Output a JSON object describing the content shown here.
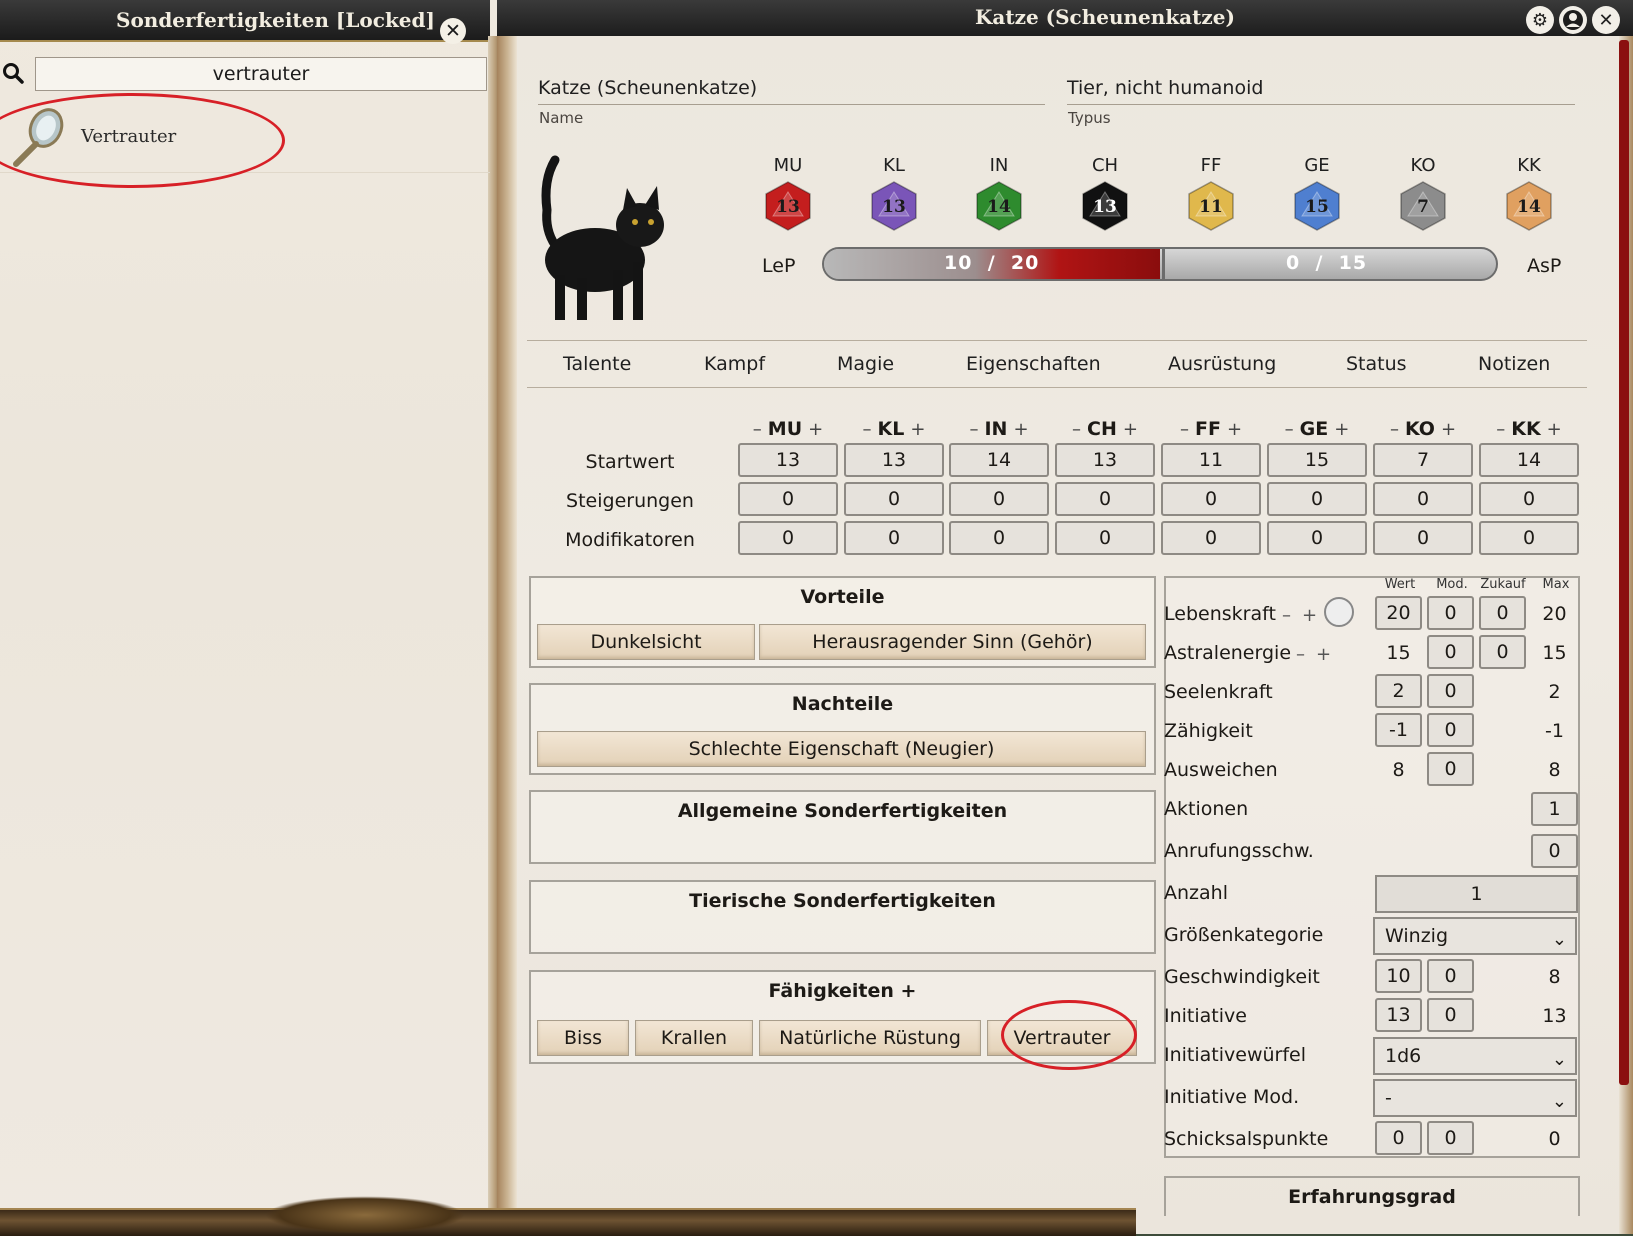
{
  "left_window": {
    "title": "Sonderfertigkeiten [Locked]",
    "search_value": "vertrauter",
    "results": [
      {
        "label": "Vertrauter"
      }
    ]
  },
  "right_window": {
    "title": "Katze (Scheunenkatze)",
    "name_value": "Katze (Scheunenkatze)",
    "name_caption": "Name",
    "type_value": "Tier, nicht humanoid",
    "type_caption": "Typus"
  },
  "attributes": [
    {
      "key": "MU",
      "value": "13",
      "color": "#c41e1e"
    },
    {
      "key": "KL",
      "value": "13",
      "color": "#7a55b8"
    },
    {
      "key": "IN",
      "value": "14",
      "color": "#2e8b2e"
    },
    {
      "key": "CH",
      "value": "13",
      "color": "#111111"
    },
    {
      "key": "FF",
      "value": "11",
      "color": "#e0b84c"
    },
    {
      "key": "GE",
      "value": "15",
      "color": "#4f7fd0"
    },
    {
      "key": "KO",
      "value": "7",
      "color": "#8c8c8c"
    },
    {
      "key": "KK",
      "value": "14",
      "color": "#e0a060"
    }
  ],
  "resources": {
    "lep_label": "LeP",
    "lep_current": "10",
    "lep_max": "20",
    "lep_fraction": 0.5,
    "asp_label": "AsP",
    "asp_current": "0",
    "asp_max": "15",
    "asp_fraction": 0.0,
    "separator": "/"
  },
  "tabs": [
    "Talente",
    "Kampf",
    "Magie",
    "Eigenschaften",
    "Ausrüstung",
    "Status",
    "Notizen"
  ],
  "attr_table": {
    "minus": "–",
    "plus": "+",
    "rows": [
      {
        "label": "Startwert",
        "values": [
          "13",
          "13",
          "14",
          "13",
          "11",
          "15",
          "7",
          "14"
        ]
      },
      {
        "label": "Steigerungen",
        "values": [
          "0",
          "0",
          "0",
          "0",
          "0",
          "0",
          "0",
          "0"
        ]
      },
      {
        "label": "Modifikatoren",
        "values": [
          "0",
          "0",
          "0",
          "0",
          "0",
          "0",
          "0",
          "0"
        ]
      }
    ]
  },
  "sections": {
    "vorteile": {
      "title": "Vorteile",
      "items": [
        "Dunkelsicht",
        "Herausragender Sinn (Gehör)"
      ]
    },
    "nachteile": {
      "title": "Nachteile",
      "items": [
        "Schlechte Eigenschaft (Neugier)"
      ]
    },
    "allgemeine": {
      "title": "Allgemeine Sonderfertigkeiten"
    },
    "tierische": {
      "title": "Tierische Sonderfertigkeiten"
    },
    "faehigkeiten": {
      "title": "Fähigkeiten",
      "add": "+",
      "items": [
        "Biss",
        "Krallen",
        "Natürliche Rüstung",
        "Vertrauter"
      ]
    }
  },
  "stats": {
    "headers": {
      "wert": "Wert",
      "mod": "Mod.",
      "zukauf": "Zukauf",
      "max": "Max"
    },
    "lebenskraft": {
      "label": "Lebenskraft",
      "wert": "20",
      "mod": "0",
      "zukauf": "0",
      "max": "20"
    },
    "astralenergie": {
      "label": "Astralenergie",
      "wert": "15",
      "mod": "0",
      "zukauf": "0",
      "max": "15"
    },
    "seelenkraft": {
      "label": "Seelenkraft",
      "wert": "2",
      "mod": "0",
      "max": "2"
    },
    "zaehigkeit": {
      "label": "Zähigkeit",
      "wert": "-1",
      "mod": "0",
      "max": "-1"
    },
    "ausweichen": {
      "label": "Ausweichen",
      "wert": "8",
      "mod": "0",
      "max": "8"
    },
    "aktionen": {
      "label": "Aktionen",
      "value": "1"
    },
    "anrufung": {
      "label": "Anrufungsschw.",
      "value": "0"
    },
    "anzahl": {
      "label": "Anzahl",
      "value": "1"
    },
    "groesse": {
      "label": "Größenkategorie",
      "value": "Winzig"
    },
    "geschwindigkeit": {
      "label": "Geschwindigkeit",
      "wert": "10",
      "mod": "0",
      "max": "8"
    },
    "initiative": {
      "label": "Initiative",
      "wert": "13",
      "mod": "0",
      "max": "13"
    },
    "iniwuerfel": {
      "label": "Initiativewürfel",
      "value": "1d6"
    },
    "inimod": {
      "label": "Initiative Mod.",
      "value": "-"
    },
    "schicksal": {
      "label": "Schicksalspunkte",
      "wert": "0",
      "mod": "0",
      "max": "0"
    },
    "minus": "–",
    "plus": "+"
  },
  "erfahrungsgrad": {
    "title": "Erfahrungsgrad"
  },
  "icons": {
    "search": "search-icon",
    "close": "close-icon",
    "settings": "gear-icon",
    "user": "user-icon",
    "moon": "moon-icon",
    "chevron": "chevron-down-icon",
    "mirror": "mirror-icon"
  }
}
